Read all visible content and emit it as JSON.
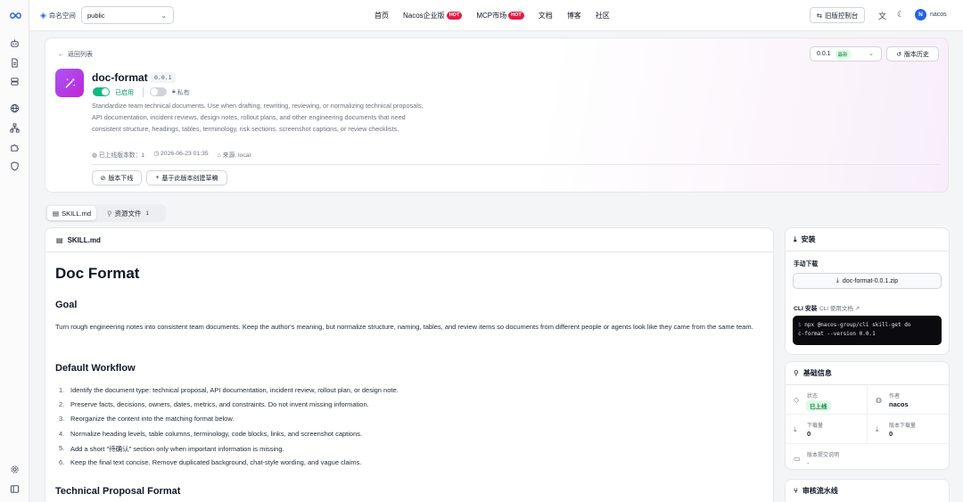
{
  "topbar": {
    "namespace_label": "命名空间",
    "namespace_value": "public",
    "nav": [
      {
        "label": "首页",
        "hot": ""
      },
      {
        "label": "Nacos企业版",
        "hot": "HOT"
      },
      {
        "label": "MCP市场",
        "hot": "HOT"
      },
      {
        "label": "文档",
        "hot": ""
      },
      {
        "label": "博客",
        "hot": ""
      },
      {
        "label": "社区",
        "hot": ""
      }
    ],
    "old_console": "旧版控制台",
    "avatar_initial": "N",
    "username": "nacos"
  },
  "hero": {
    "back_label": "返回列表",
    "skill_name": "doc-format",
    "version_tag": "0.0.1",
    "enabled_label": "已启用",
    "enabled": true,
    "private_label": "私有",
    "private": false,
    "description": "Standardize team technical documents. Use when drafting, rewriting, reviewing, or normalizing technical proposals, API documentation, incident reviews, design notes, rollout plans, and other engineering documents that need consistent structure, headings, tables, terminology, risk sections, screenshot captions, or review checklists.",
    "meta_online_versions": "已上线版本数：1",
    "meta_date": "2026-06-23 01:35",
    "meta_source": "来源: local",
    "offline_button": "版本下线",
    "draft_button": "基于此版本创建草稿",
    "version_select": "0.0.1",
    "latest_badge": "最新",
    "history_button": "版本历史"
  },
  "tabs": [
    {
      "label": "SKILL.md",
      "count": ""
    },
    {
      "label": "资源文件",
      "count": "1"
    }
  ],
  "doc": {
    "file_name": "SKILL.md",
    "title": "Doc Format",
    "goal_heading": "Goal",
    "goal_text": "Turn rough engineering notes into consistent team documents. Keep the author's meaning, but normalize structure, naming, tables, and review items so documents from different people or agents look like they came from the same team.",
    "workflow_heading": "Default Workflow",
    "workflow_items": [
      "Identify the document type: technical proposal, API documentation, incident review, rollout plan, or design note.",
      "Preserve facts, decisions, owners, dates, metrics, and constraints. Do not invent missing information.",
      "Reorganize the content into the matching format below.",
      "Normalize heading levels, table columns, terminology, code blocks, links, and screenshot captions.",
      "Add a short \"待确认\" section only when important information is missing.",
      "Keep the final text concise. Remove duplicated background, chat-style wording, and vague claims."
    ],
    "proposal_heading": "Technical Proposal Format"
  },
  "install": {
    "title": "安装",
    "manual_label": "手动下载",
    "download_button": "doc-format-0.0.1.zip",
    "cli_label": "CLI 安装",
    "cli_doc_link": "CLI 使用文档",
    "prompt": "$",
    "command_line1": "npx @nacos-group/cli skill-get do",
    "command_line2": "c-format --version 0.0.1"
  },
  "basic_info": {
    "title": "基础信息",
    "status_label": "状态",
    "status_value": "已上线",
    "author_label": "作者",
    "author_value": "nacos",
    "downloads_label": "下载量",
    "downloads_value": "0",
    "version_downloads_label": "版本下载量",
    "version_downloads_value": "0",
    "commit_note_label": "版本提交说明",
    "commit_note_value": "-"
  },
  "review": {
    "title": "审核流水线"
  },
  "colors": {
    "accent": "#10b981",
    "hot": "#e11d48",
    "avatar": "#2563eb",
    "skill_icon_from": "#a855f7",
    "skill_icon_to": "#c026d3"
  }
}
